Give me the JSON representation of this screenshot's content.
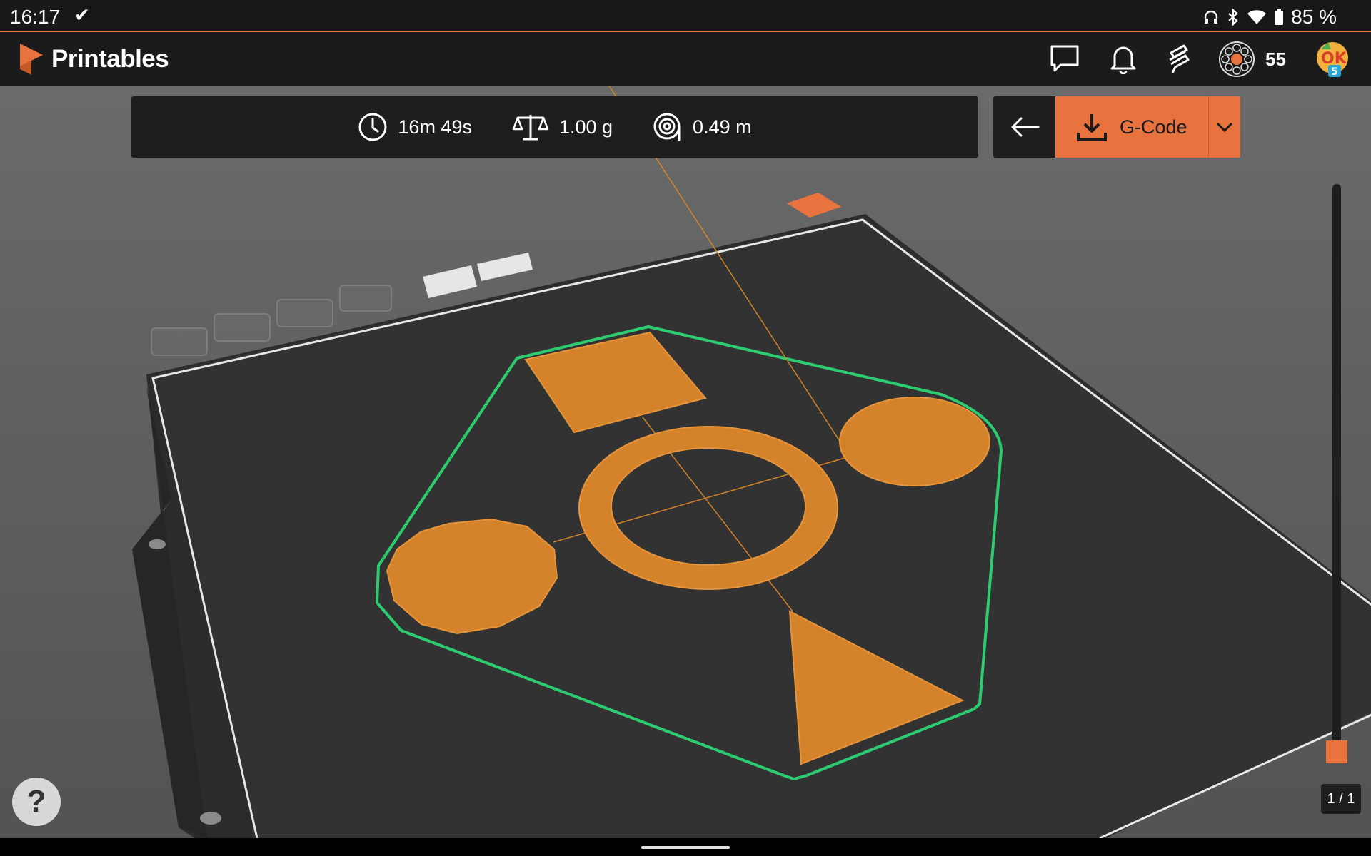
{
  "status_bar": {
    "time": "16:17",
    "battery": "85 %"
  },
  "app": {
    "name": "Printables",
    "brand_color": "#e8733f",
    "points": "55",
    "avatar_badge": "5",
    "avatar_text": "OK"
  },
  "print_info": {
    "time": "16m 49s",
    "weight": "1.00 g",
    "filament": "0.49 m"
  },
  "actions": {
    "download_label": "G-Code"
  },
  "layer_slider": {
    "label": "1 / 1",
    "level": 0.0
  },
  "help": {
    "label": "?"
  },
  "icons": [
    "clock-icon",
    "scale-icon",
    "filament-spool-icon",
    "back-arrow-icon",
    "download-icon",
    "chevron-down-icon",
    "chat-icon",
    "bell-icon",
    "slicer-icon",
    "points-icon"
  ],
  "colors": {
    "object": "#d4832a",
    "outline": "#2ecc71",
    "bed": "#323232"
  }
}
